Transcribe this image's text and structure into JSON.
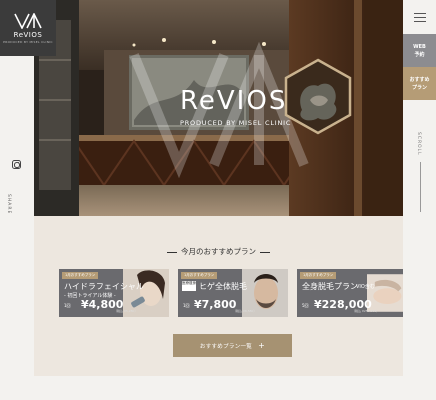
{
  "brand": {
    "logo_text": "ReVIOS",
    "logo_sub": "PRODUCED BY MISEL CLINIC"
  },
  "left_rail": {
    "share_label": "SHARE"
  },
  "hero": {
    "title": "ReVIOS",
    "subtitle": "PRODUCED BY MISEL CLINIC"
  },
  "right_rail": {
    "web_reserve_line1": "WEB",
    "web_reserve_line2": "予約",
    "plan_line1": "おすすめ",
    "plan_line2": "プラン",
    "scroll_label": "SCROLL"
  },
  "plans": {
    "section_title": "今月のおすすめプラン",
    "cards": [
      {
        "tag": "1月おすすめプラン",
        "name": "ハイドラフェイシャル",
        "sub": "- 初回トライアル体験 -",
        "price": "¥4,800",
        "price_prefix": "1回",
        "note": "（税込 ¥5,280）"
      },
      {
        "tag": "1月おすすめプラン",
        "name": "ヒゲ全体脱毛",
        "badge": "医療痩身",
        "price": "¥7,800",
        "price_prefix": "1回",
        "note": "（税込 ¥8,580）"
      },
      {
        "tag": "1月おすすめプラン",
        "name": "全身脱毛プラン",
        "sub": "VIO含む",
        "price": "¥228,000",
        "price_prefix": "5回",
        "note": "（税込 ¥250,800）"
      }
    ],
    "more_button": "おすすめプラン一覧"
  },
  "colors": {
    "accent_gold": "#b59c76",
    "logo_bg": "#3b3b3b",
    "web_reserve_bg": "#8c8c90",
    "section_bg": "#ede7df",
    "button_bg": "#a69272"
  }
}
